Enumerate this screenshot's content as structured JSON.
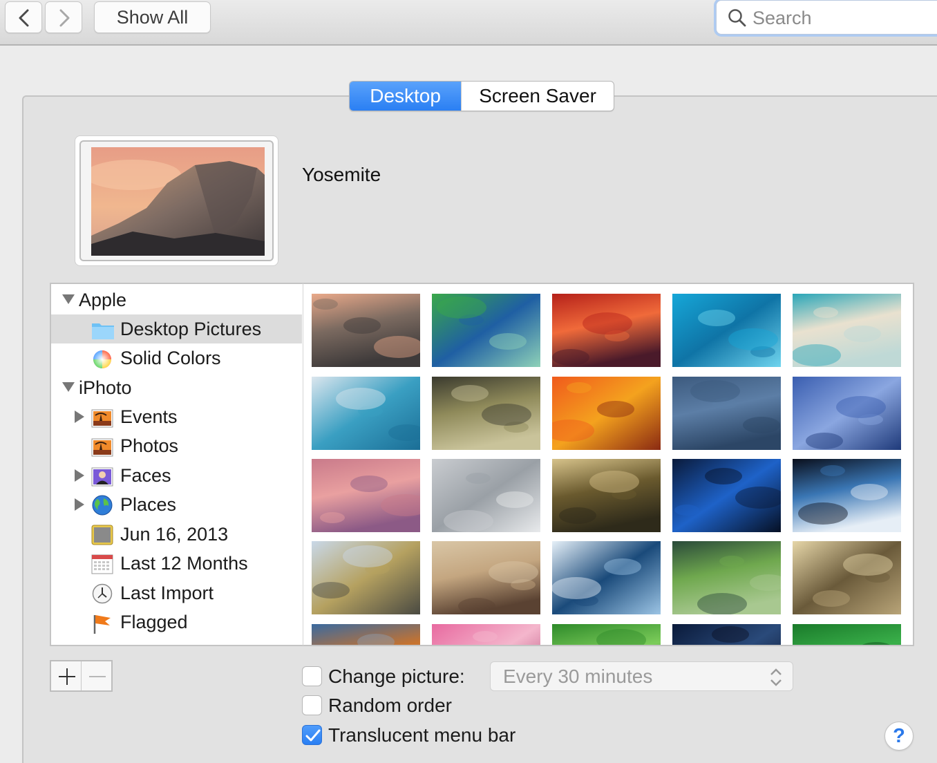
{
  "toolbar": {
    "back_icon": "chevron-left-icon",
    "forward_icon": "chevron-right-icon",
    "show_all_label": "Show All",
    "search_placeholder": "Search"
  },
  "tabs": [
    {
      "label": "Desktop",
      "selected": true
    },
    {
      "label": "Screen Saver",
      "selected": false
    }
  ],
  "current_wallpaper": {
    "name": "Yosemite"
  },
  "sidebar": {
    "items": [
      {
        "label": "Apple",
        "icon": "disclosure-open",
        "level": 0
      },
      {
        "label": "Desktop Pictures",
        "icon": "folder-icon",
        "level": 1,
        "selected": true
      },
      {
        "label": "Solid Colors",
        "icon": "color-wheel-icon",
        "level": 1
      },
      {
        "label": "iPhoto",
        "icon": "disclosure-open",
        "level": 0
      },
      {
        "label": "Events",
        "icon": "events-icon",
        "level": 1,
        "disclosure": true
      },
      {
        "label": "Photos",
        "icon": "photos-icon",
        "level": 1
      },
      {
        "label": "Faces",
        "icon": "faces-icon",
        "level": 1,
        "disclosure": true
      },
      {
        "label": "Places",
        "icon": "globe-icon",
        "level": 1,
        "disclosure": true
      },
      {
        "label": "Jun 16, 2013",
        "icon": "album-icon",
        "level": 1
      },
      {
        "label": "Last 12 Months",
        "icon": "calendar-icon",
        "level": 1
      },
      {
        "label": "Last Import",
        "icon": "clock-icon",
        "level": 1
      },
      {
        "label": "Flagged",
        "icon": "flag-icon",
        "level": 1
      }
    ]
  },
  "thumbnails": [
    {
      "name": "yosemite",
      "colors": [
        "#e9a98a",
        "#7b6a60",
        "#3e3a3a"
      ]
    },
    {
      "name": "green-algae",
      "colors": [
        "#3aa84a",
        "#1f5fa3",
        "#8ed1b8"
      ]
    },
    {
      "name": "antelope-canyon",
      "colors": [
        "#b5211a",
        "#f06a3a",
        "#4a1a2a"
      ]
    },
    {
      "name": "turquoise-water",
      "colors": [
        "#16a7d8",
        "#0f74a6",
        "#6fd4ee"
      ]
    },
    {
      "name": "beach",
      "colors": [
        "#2aa6b8",
        "#e9e1cf",
        "#bfd9d6"
      ]
    },
    {
      "name": "blue-forest",
      "colors": [
        "#dbe6ee",
        "#3a9fc2",
        "#1b6e96"
      ]
    },
    {
      "name": "grass-seeds",
      "colors": [
        "#3a3a2e",
        "#8f8a5a",
        "#c9c39a"
      ]
    },
    {
      "name": "orange-abstract",
      "colors": [
        "#f05a1c",
        "#f4a21e",
        "#8a2a12"
      ]
    },
    {
      "name": "blue-waves",
      "colors": [
        "#3c5a7e",
        "#5c7ea6",
        "#2c4666"
      ]
    },
    {
      "name": "blue-mountains",
      "colors": [
        "#3a5eb0",
        "#8aa6e0",
        "#1f3a7a"
      ]
    },
    {
      "name": "pink-dunes",
      "colors": [
        "#c97a8a",
        "#e9a0a0",
        "#8c5a86"
      ]
    },
    {
      "name": "misty-lake",
      "colors": [
        "#c9ccd0",
        "#9aa0a6",
        "#e8eaec"
      ]
    },
    {
      "name": "waterfall",
      "colors": [
        "#d6c28a",
        "#6a5a2e",
        "#2e2a1a"
      ]
    },
    {
      "name": "earth-moon",
      "colors": [
        "#0a1a3a",
        "#1e62c8",
        "#061024"
      ]
    },
    {
      "name": "earth-clouds",
      "colors": [
        "#0a0f1c",
        "#3a76b4",
        "#e6eef6"
      ]
    },
    {
      "name": "elephant",
      "colors": [
        "#c9d8e8",
        "#b5a160",
        "#4a4a42"
      ]
    },
    {
      "name": "flamingos",
      "colors": [
        "#d9c6a6",
        "#c4a680",
        "#5a4232"
      ]
    },
    {
      "name": "ice-cracks",
      "colors": [
        "#e6f0f8",
        "#1a4a7a",
        "#9cc4e4"
      ]
    },
    {
      "name": "lily-pads",
      "colors": [
        "#2a4a3a",
        "#6fa84e",
        "#a8c890"
      ]
    },
    {
      "name": "sunlit-fog",
      "colors": [
        "#e6d6a8",
        "#6a5a3a",
        "#b8a478"
      ]
    },
    {
      "name": "autumn-hills",
      "colors": [
        "#3a6aa0",
        "#c8732e",
        "#8ea0b4"
      ]
    },
    {
      "name": "pink-grass",
      "colors": [
        "#e86aa0",
        "#f4b6cc",
        "#a83a6a"
      ]
    },
    {
      "name": "green-leaf",
      "colors": [
        "#2e8a2a",
        "#7ccc5a",
        "#1a5a1a"
      ]
    },
    {
      "name": "night-sky",
      "colors": [
        "#0a1a3a",
        "#2a4a7a",
        "#0a0f24"
      ]
    },
    {
      "name": "green-grass",
      "colors": [
        "#1a7a2a",
        "#3ab04a",
        "#0e4a1a"
      ]
    }
  ],
  "controls": {
    "add_icon": "plus-icon",
    "remove_icon": "minus-icon",
    "change_picture": {
      "label": "Change picture:",
      "checked": false
    },
    "interval_value": "Every 30 minutes",
    "random_order": {
      "label": "Random order",
      "checked": false
    },
    "translucent_menu_bar": {
      "label": "Translucent menu bar",
      "checked": true
    },
    "help_label": "?"
  },
  "colors": {
    "accent": "#2a7ff3",
    "window_bg": "#ececec",
    "panel_bg": "#e2e2e2"
  }
}
